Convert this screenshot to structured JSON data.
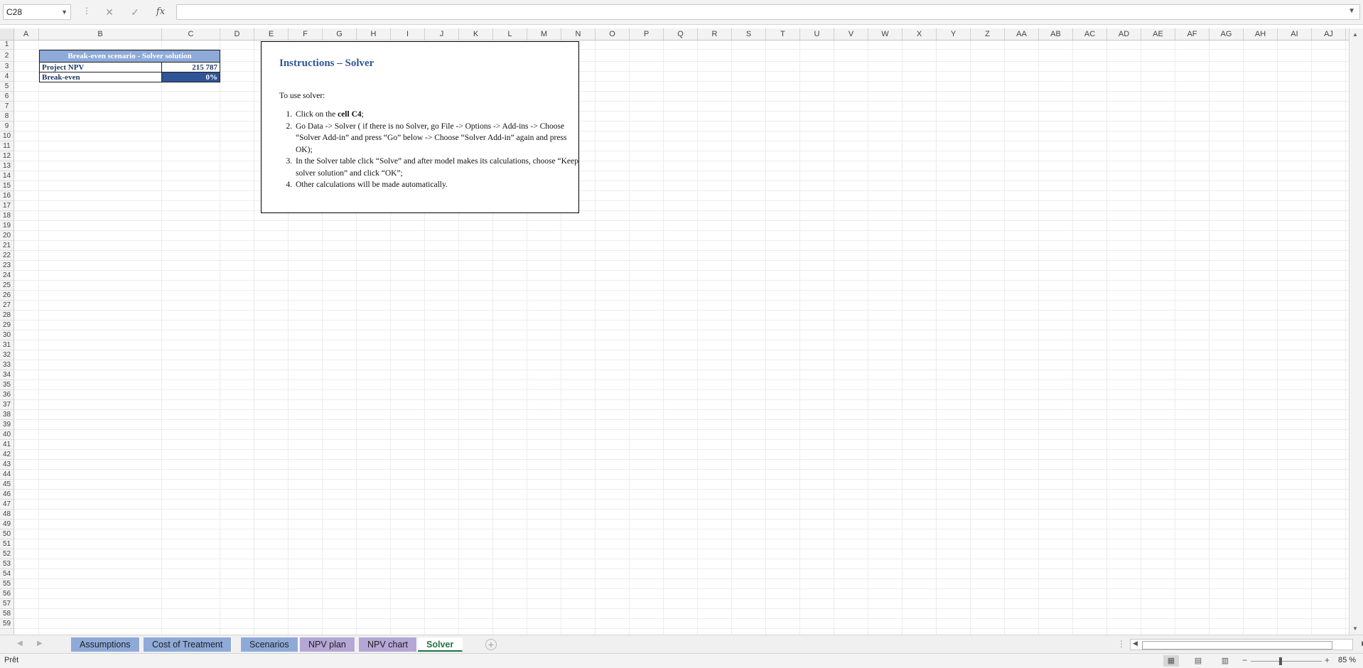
{
  "formula_bar": {
    "name_box": "C28",
    "cancel_icon": "✕",
    "enter_icon": "✓",
    "fx_label": "fx",
    "formula_value": ""
  },
  "columns": [
    "A",
    "B",
    "C",
    "D",
    "E",
    "F",
    "G",
    "H",
    "I",
    "J",
    "K",
    "L",
    "M",
    "N",
    "O",
    "P",
    "Q",
    "R",
    "S",
    "T",
    "U",
    "V",
    "W",
    "X",
    "Y",
    "Z",
    "AA",
    "AB",
    "AC",
    "AD",
    "AE",
    "AF",
    "AG",
    "AH",
    "AI",
    "AJ"
  ],
  "rows_count": 59,
  "solver_table": {
    "title": "Break-even scenario - Solver solution",
    "rows": [
      {
        "label": "Project NPV",
        "value": "215 787"
      },
      {
        "label": "Break-even",
        "value": "0%"
      }
    ]
  },
  "instructions": {
    "title": "Instructions – Solver",
    "intro": "To use solver:",
    "step1_prefix": "Click on the ",
    "step1_bold": "cell C4",
    "step1_suffix": ";",
    "step2": "Go Data -> Solver ( if there is no Solver, go File -> Options -> Add-ins -> Choose “Solver Add-in” and press “Go” below -> Choose “Solver Add-in” again and press OK);",
    "step3": "In the Solver table click “Solve” and after model makes its calculations, choose “Keep solver solution” and click “OK”;",
    "step4": "Other calculations will be made automatically."
  },
  "sheet_tabs": [
    {
      "label": "Assumptions",
      "color": "#8eaad8"
    },
    {
      "label": "Cost of Treatment",
      "color": "#8eaad8"
    },
    {
      "label": "Scenarios",
      "color": "#8eaad8"
    },
    {
      "label": "NPV plan",
      "color": "#b4a7d6"
    },
    {
      "label": "NPV chart",
      "color": "#b4a7d6"
    },
    {
      "label": "Solver",
      "color": "#ffffff",
      "active": true
    }
  ],
  "status_bar": {
    "ready_text": "Prêt",
    "zoom_text": "85 %"
  },
  "colors": {
    "accent_green": "#217346",
    "table_title_bg": "#8eaad8",
    "breakeven_bg": "#2f5597",
    "heading_blue": "#2f5597"
  }
}
